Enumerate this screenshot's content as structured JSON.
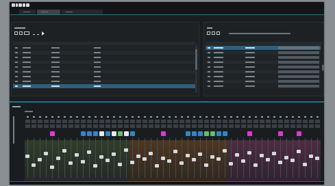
{
  "window": {
    "tabs": [
      "",
      "",
      ""
    ],
    "active_tab": 1
  },
  "colors": {
    "accent": "#2b6d8c",
    "selection": "#2f5f7e",
    "magenta": "#e036d8",
    "group_green": "#5a7d3c",
    "group_orange": "#b9691f",
    "group_pink": "#b94887"
  },
  "scenes": {
    "title": "",
    "toolbar_icons": [
      "new-scene-icon",
      "duplicate-icon",
      "edit-icon",
      "move-down-icon",
      "move-up-icon",
      "play-icon"
    ],
    "columns": [
      "",
      "",
      "",
      ""
    ],
    "rows": 9,
    "selected_row": 8
  },
  "cues": {
    "title": "",
    "toolbar_icons": [
      "new-cue-icon",
      "duplicate-icon",
      "settings-icon"
    ],
    "header_info": "",
    "columns": [
      "",
      "",
      "",
      ""
    ],
    "rows": 9,
    "selected_row": 0
  },
  "mixer": {
    "title": "",
    "subtitle": "",
    "vertical_label": "",
    "channel_count": 48,
    "fader_levels": [
      0.55,
      0.3,
      0.45,
      0.62,
      0.25,
      0.5,
      0.7,
      0.35,
      0.58,
      0.4,
      0.66,
      0.28,
      0.52,
      0.44,
      0.6,
      0.33,
      0.72,
      0.38,
      0.55,
      0.47,
      0.63,
      0.29,
      0.5,
      0.41,
      0.68,
      0.36,
      0.57,
      0.45,
      0.61,
      0.31,
      0.53,
      0.48,
      0.7,
      0.34,
      0.59,
      0.42,
      0.65,
      0.3,
      0.56,
      0.46,
      0.62,
      0.37,
      0.51,
      0.43,
      0.67,
      0.32,
      0.54,
      0.49
    ],
    "slot_colors": {
      "4": "#e036d8",
      "9": "#2f86c9",
      "10": "#2f86c9",
      "11": "#2f86c9",
      "12": "#e8e8e8",
      "13": "#2f86c9",
      "14": "#e8e8e8",
      "15": "#5ec06a",
      "16": "#e8e8e8",
      "17": "#2f86c9",
      "22": "#e036d8",
      "26": "#2f86c9",
      "27": "#2f86c9",
      "28": "#2f86c9",
      "29": "#5ec06a",
      "30": "#5ec06a",
      "31": "#2f86c9",
      "32": "#2f86c9",
      "36": "#e036d8",
      "41": "#e036d8",
      "44": "#e036d8"
    },
    "groups": [
      {
        "color": "#5a7d3c",
        "from": 0,
        "to": 17
      },
      {
        "color": "#b9691f",
        "from": 17,
        "to": 33
      },
      {
        "color": "#b94887",
        "from": 33,
        "to": 48
      }
    ]
  }
}
